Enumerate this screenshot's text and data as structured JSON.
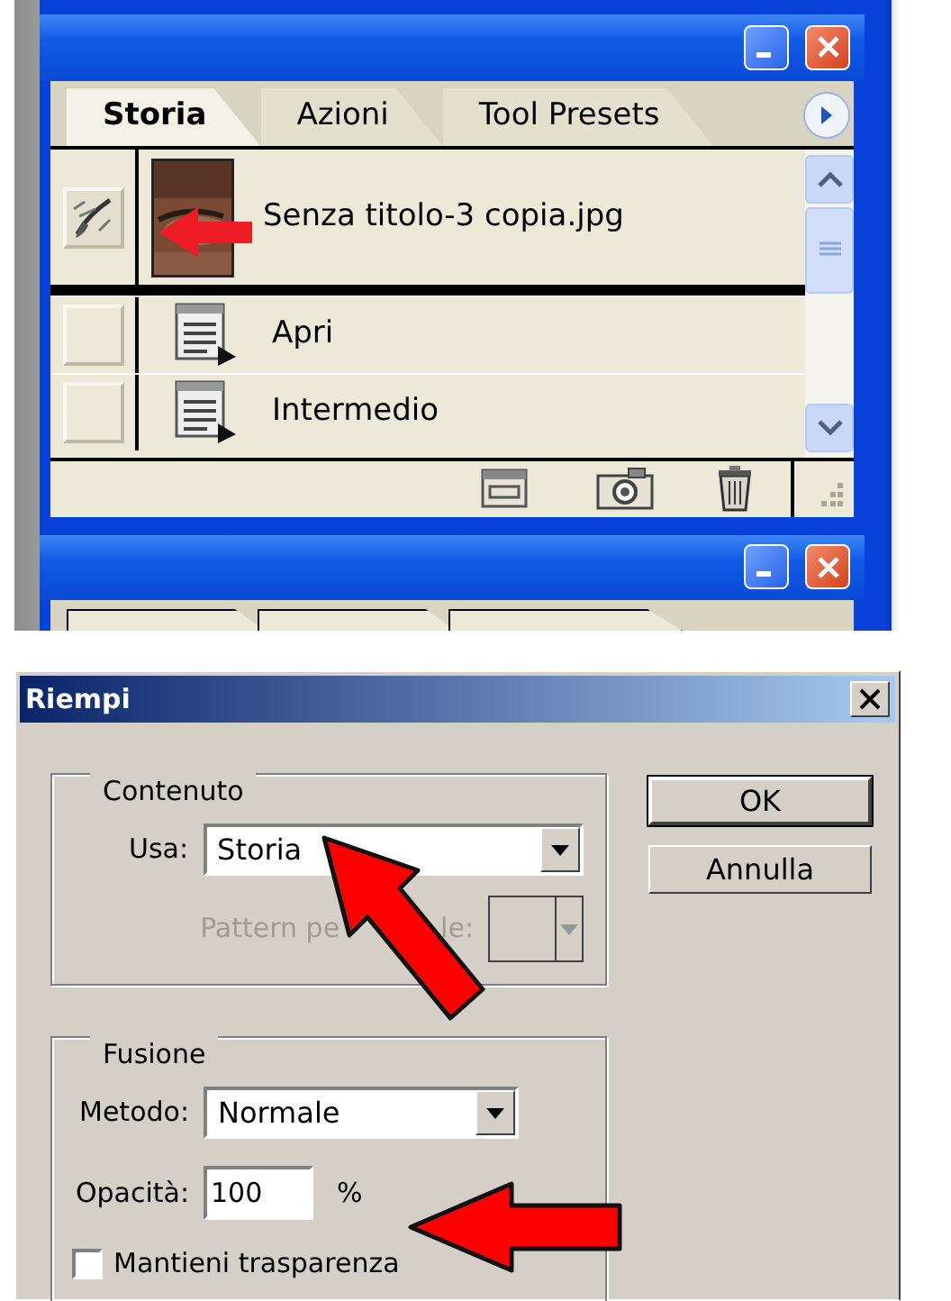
{
  "history_panel": {
    "tabs": [
      {
        "label": "Storia",
        "selected": true
      },
      {
        "label": "Azioni",
        "selected": false
      },
      {
        "label": "Tool Presets",
        "selected": false
      }
    ],
    "snapshot": {
      "name": "Senza titolo-3 copia.jpg",
      "source": true
    },
    "steps": [
      {
        "label": "Apri",
        "source": false
      },
      {
        "label": "Intermedio",
        "source": false
      }
    ]
  },
  "dialog": {
    "title": "Riempi",
    "content": {
      "legend": "Contenuto",
      "use_label": "Usa:",
      "use_value": "Storia",
      "pattern_label_parts": [
        "Pattern pe",
        "le:"
      ],
      "pattern_disabled": true
    },
    "blending": {
      "legend": "Fusione",
      "mode_label": "Metodo:",
      "mode_value": "Normale",
      "opacity_label": "Opacità:",
      "opacity_value": "100",
      "opacity_unit": "%",
      "preserve_label": "Mantieni trasparenza",
      "preserve_checked": false
    },
    "buttons": [
      {
        "label": "OK",
        "default": true
      },
      {
        "label": "Annulla",
        "default": false
      }
    ]
  }
}
